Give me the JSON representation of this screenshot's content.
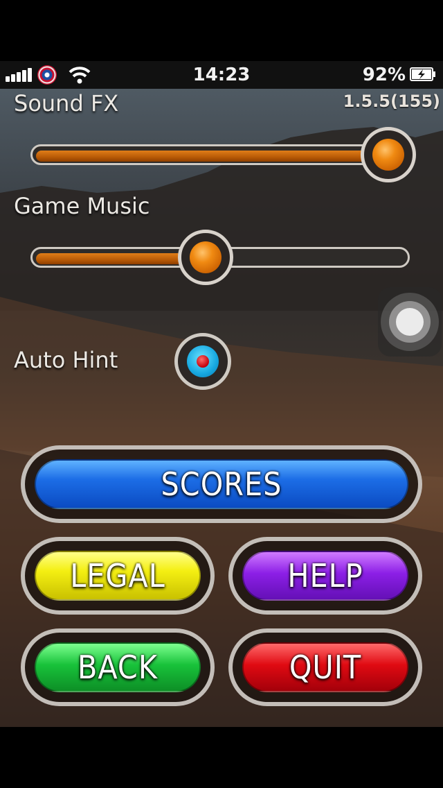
{
  "status_bar": {
    "time": "14:23",
    "battery_percent": "92%",
    "signal_bars": 5,
    "wifi_icon": "wifi-icon",
    "carrier_icon": "shield-badge-icon",
    "battery_level": 0.92
  },
  "version": "1.5.5(155)",
  "settings": {
    "sound_fx": {
      "label": "Sound FX",
      "value": 0.96
    },
    "game_music": {
      "label": "Game Music",
      "value": 0.46
    },
    "auto_hint": {
      "label": "Auto Hint",
      "enabled": true
    }
  },
  "buttons": {
    "scores": "SCORES",
    "legal": "LEGAL",
    "help": "HELP",
    "back": "BACK",
    "quit": "QUIT"
  },
  "colors": {
    "slider_fill": "#e07d18",
    "scores": "#1c6de6",
    "legal": "#f4ef12",
    "help": "#8c1fe6",
    "back": "#18c23a",
    "quit": "#e00a12"
  }
}
